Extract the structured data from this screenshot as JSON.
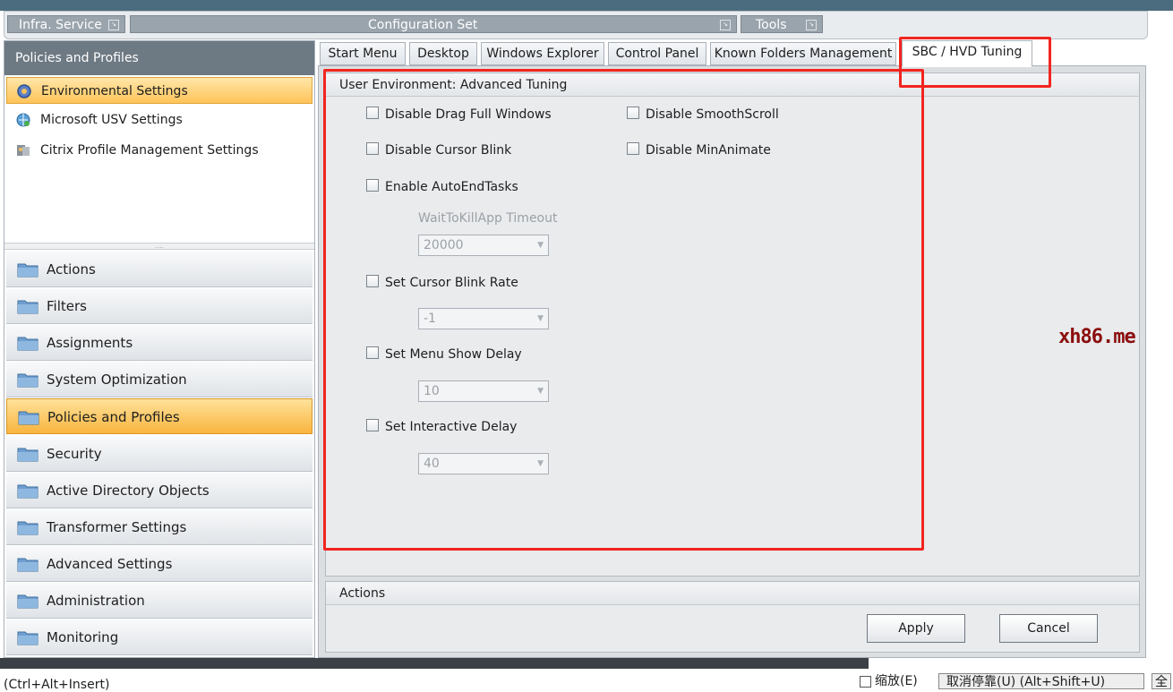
{
  "ribbon": {
    "groups": [
      "Infra. Service",
      "Configuration Set",
      "Tools"
    ]
  },
  "left_panel": {
    "header": "Policies and Profiles",
    "items": [
      {
        "label": "Environmental Settings",
        "icon": "gear-icon",
        "selected": true
      },
      {
        "label": "Microsoft USV Settings",
        "icon": "globe-user-icon",
        "selected": false
      },
      {
        "label": "Citrix Profile Management Settings",
        "icon": "citrix-profile-icon",
        "selected": false
      }
    ],
    "splitter_grip": "....",
    "nav_buttons": [
      {
        "label": "Actions",
        "selected": false
      },
      {
        "label": "Filters",
        "selected": false
      },
      {
        "label": "Assignments",
        "selected": false
      },
      {
        "label": "System Optimization",
        "selected": false
      },
      {
        "label": "Policies and Profiles",
        "selected": true
      },
      {
        "label": "Security",
        "selected": false
      },
      {
        "label": "Active Directory Objects",
        "selected": false
      },
      {
        "label": "Transformer Settings",
        "selected": false
      },
      {
        "label": "Advanced Settings",
        "selected": false
      },
      {
        "label": "Administration",
        "selected": false
      },
      {
        "label": "Monitoring",
        "selected": false
      }
    ]
  },
  "tabs": [
    {
      "label": "Start Menu",
      "active": false
    },
    {
      "label": "Desktop",
      "active": false
    },
    {
      "label": "Windows Explorer",
      "active": false
    },
    {
      "label": "Control Panel",
      "active": false
    },
    {
      "label": "Known Folders Management",
      "active": false
    },
    {
      "label": "SBC / HVD Tuning",
      "active": true
    }
  ],
  "tuning": {
    "title": "User Environment: Advanced Tuning",
    "checkboxes": {
      "disable_drag_full_windows": {
        "label": "Disable Drag Full Windows",
        "checked": false
      },
      "disable_smooth_scroll": {
        "label": "Disable SmoothScroll",
        "checked": false
      },
      "disable_cursor_blink": {
        "label": "Disable Cursor Blink",
        "checked": false
      },
      "disable_min_animate": {
        "label": "Disable MinAnimate",
        "checked": false
      },
      "enable_auto_end_tasks": {
        "label": "Enable AutoEndTasks",
        "checked": false
      },
      "set_cursor_blink_rate": {
        "label": "Set Cursor Blink Rate",
        "checked": false
      },
      "set_menu_show_delay": {
        "label": "Set Menu Show Delay",
        "checked": false
      },
      "set_interactive_delay": {
        "label": "Set Interactive Delay",
        "checked": false
      }
    },
    "wait_to_kill_label": "WaitToKillApp Timeout",
    "combos": {
      "wait_to_kill": "20000",
      "cursor_blink_rate": "-1",
      "menu_show_delay": "10",
      "interactive_delay": "40"
    }
  },
  "actions": {
    "title": "Actions",
    "apply": "Apply",
    "cancel": "Cancel"
  },
  "watermark": "xh86.me",
  "status_bar": {
    "left": "(Ctrl+Alt+Insert)",
    "zoom_checkbox": "缩放(E)",
    "release_button": "取消停靠(U) (Alt+Shift+U)",
    "right_partial": "全"
  },
  "colors": {
    "highlight": "#f2241f",
    "selected_nav": "#f9b43e",
    "header_bg": "#6d7983"
  }
}
